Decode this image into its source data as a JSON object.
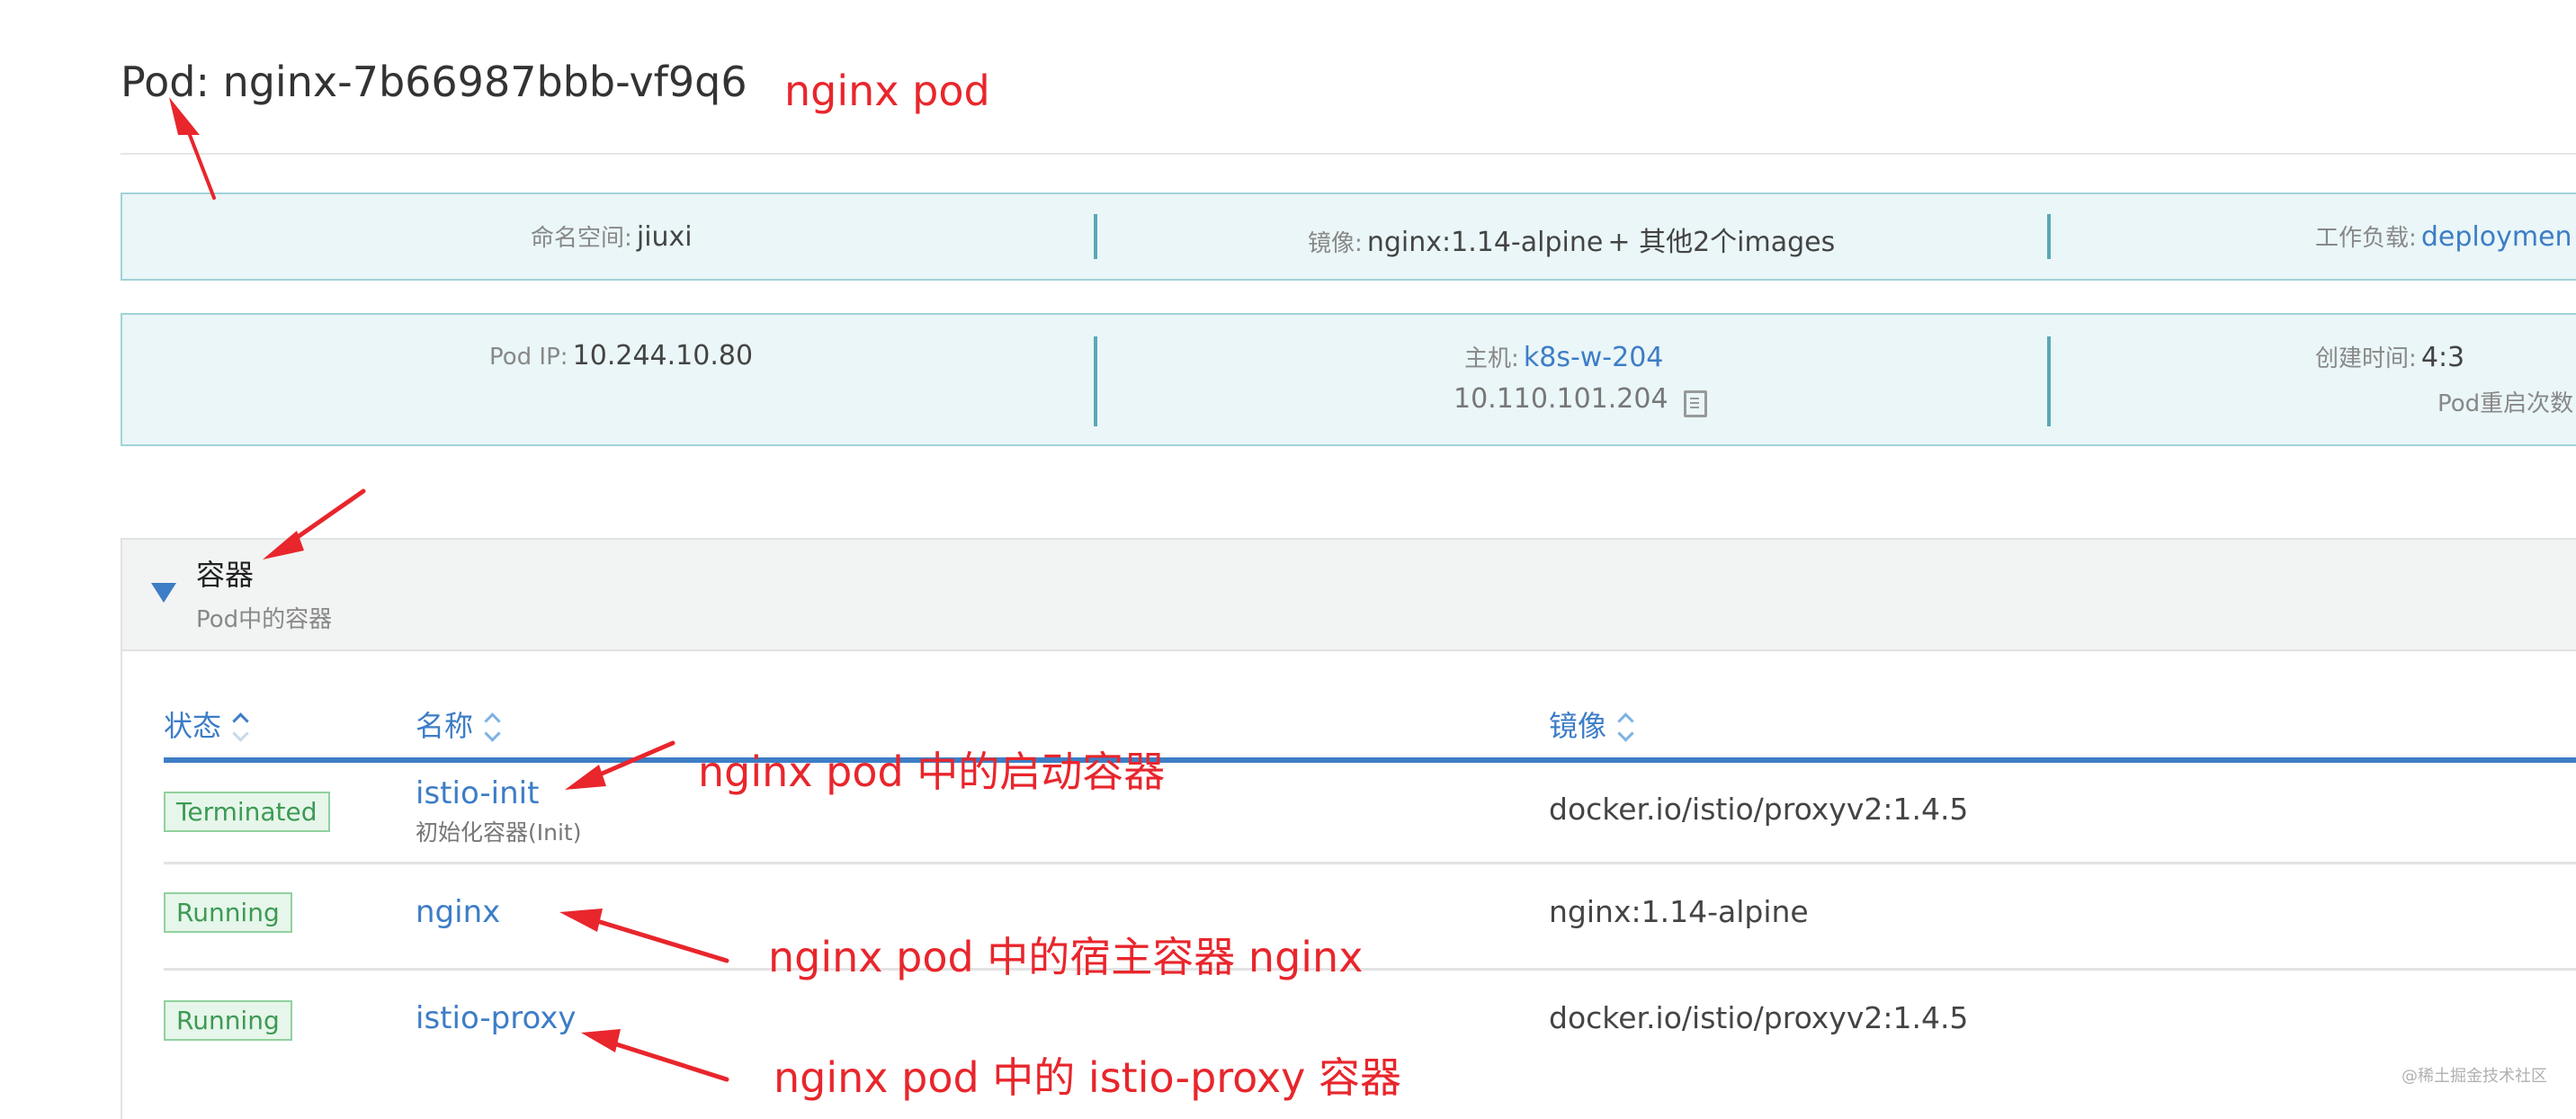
{
  "page": {
    "title_prefix": "Pod:",
    "title_name": "nginx-7b66987bbb-vf9q6"
  },
  "summary_row1": {
    "namespace_label": "命名空间:",
    "namespace_value": "jiuxi",
    "image_label": "镜像:",
    "image_value": "nginx:1.14-alpine",
    "image_more": "+ 其他2个images",
    "workload_label": "工作负载:",
    "workload_value": "deploymen"
  },
  "summary_row2": {
    "pod_ip_label": "Pod IP:",
    "pod_ip_value": "10.244.10.80",
    "host_label": "主机:",
    "host_value": "k8s-w-204",
    "host_ip": "10.110.101.204",
    "created_label": "创建时间:",
    "created_value": "4:3",
    "restart_label": "Pod重启次数"
  },
  "containers_section": {
    "title": "容器",
    "subtitle": "Pod中的容器"
  },
  "table": {
    "columns": {
      "status": "状态",
      "name": "名称",
      "image": "镜像"
    },
    "rows": [
      {
        "status": "Terminated",
        "name": "istio-init",
        "subtitle": "初始化容器(Init)",
        "image": "docker.io/istio/proxyv2:1.4.5"
      },
      {
        "status": "Running",
        "name": "nginx",
        "subtitle": "",
        "image": "nginx:1.14-alpine"
      },
      {
        "status": "Running",
        "name": "istio-proxy",
        "subtitle": "",
        "image": "docker.io/istio/proxyv2:1.4.5"
      }
    ]
  },
  "annotations": {
    "pod": "nginx pod",
    "init": "nginx pod 中的启动容器",
    "host": "nginx pod 中的宿主容器 nginx",
    "proxy": "nginx pod 中的 istio-proxy 容器"
  },
  "watermark": "@稀土掘金技术社区",
  "colors": {
    "link": "#3d7dc6",
    "annotation": "#e8262c",
    "card_bg": "#eaf6f7",
    "card_border": "#9fd3d8",
    "running_badge": "#3c9a55"
  },
  "icons": {
    "copy": "copy-icon",
    "expand": "triangle-down-icon",
    "sort": "sort-icon"
  }
}
